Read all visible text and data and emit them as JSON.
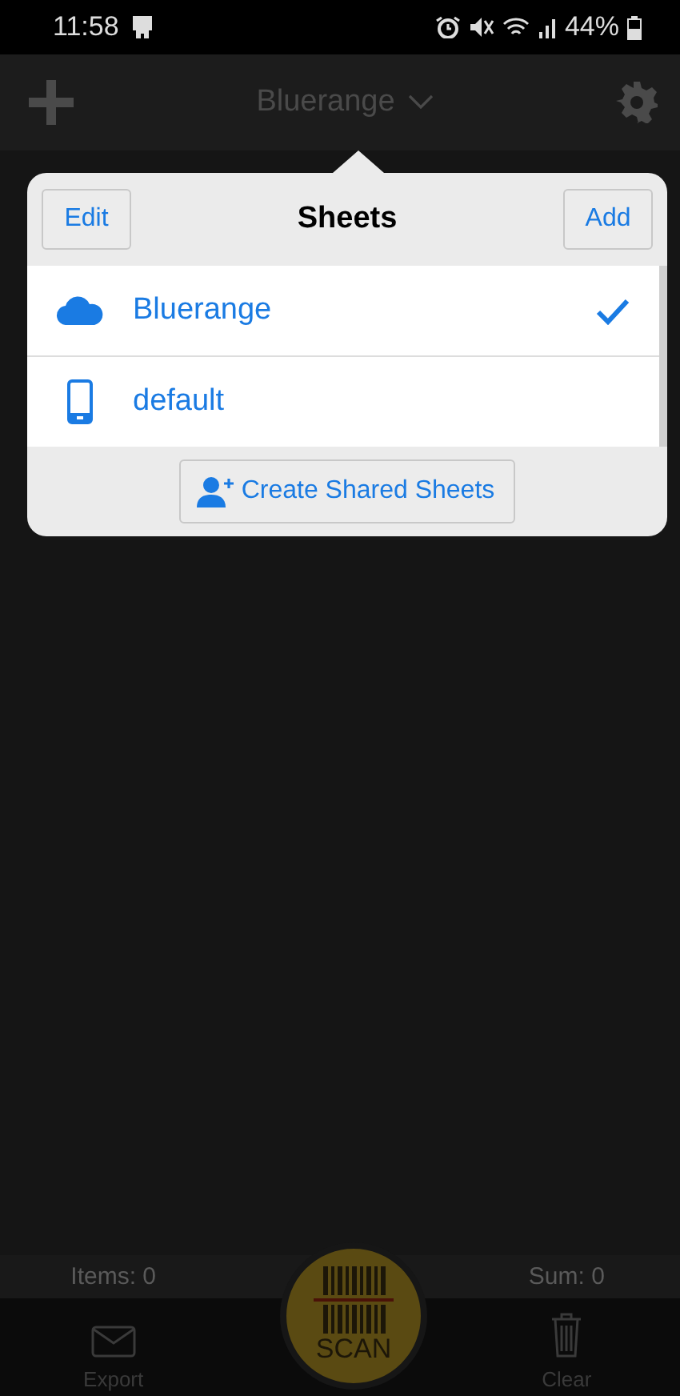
{
  "status_bar": {
    "time": "11:58",
    "battery": "44%"
  },
  "app_bar": {
    "title": "Bluerange"
  },
  "popover": {
    "title": "Sheets",
    "edit_button": "Edit",
    "add_button": "Add",
    "sheets": [
      {
        "name": "Bluerange",
        "kind": "cloud",
        "selected": true
      },
      {
        "name": "default",
        "kind": "phone",
        "selected": false
      }
    ],
    "create_button": "Create Shared Sheets"
  },
  "summary": {
    "items": "Items: 0",
    "sum": "Sum: 0"
  },
  "bottom_bar": {
    "export": "Export",
    "scan": "SCAN",
    "clear": "Clear"
  }
}
